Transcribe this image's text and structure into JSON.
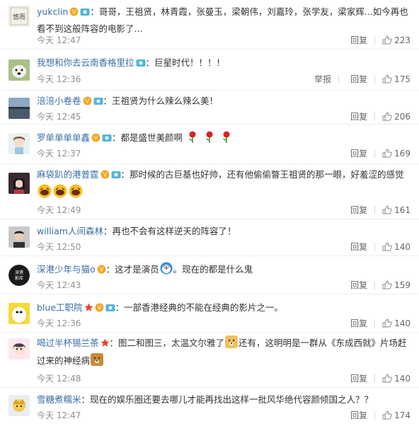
{
  "comments": [
    {
      "username": "yukclin",
      "text": "：哥哥，王祖贤，林青霞，张曼玉，梁朝伟，刘嘉玲，张学友，梁家辉...如今再也看不到这般阵容的电影了...",
      "time": "今天 12:47",
      "reply_label": "回复",
      "likes": "223",
      "avatar_icon": "calligraphy-avatar"
    },
    {
      "username": "我想和你去云南香格里拉",
      "text": "：巨星时代！！！！",
      "time": "今天 12:36",
      "report_label": "举报",
      "reply_label": "回复",
      "likes": "175",
      "avatar_icon": "dog-avatar"
    },
    {
      "username": "涪涪小卷卷",
      "text": "：王祖贤为什么辣么辣么美！",
      "time": "今天 12:45",
      "reply_label": "回复",
      "likes": "206",
      "avatar_icon": "lake-avatar"
    },
    {
      "username": "罗单单单单鑫",
      "text": "：都是盛世美颜啊",
      "time": "今天 12:37",
      "reply_label": "回复",
      "likes": "169",
      "avatar_icon": "girl-avatar"
    },
    {
      "username": "麻袋趴的港普霆",
      "text": "：那时候的古巨基也好帅，还有他偷偷瞥王祖贤的那一眼，好羞涩的感觉",
      "time": "今天 12:49",
      "reply_label": "回复",
      "likes": "161",
      "avatar_icon": "woman-avatar"
    },
    {
      "username": "william人间森林",
      "text": "：再也不会有这样逆天的阵容了！",
      "time": "今天 12:50",
      "reply_label": "回复",
      "likes": "140",
      "avatar_icon": "man-avatar"
    },
    {
      "username": "深港少年与猫o",
      "text": "：这才是演员",
      "text2": "。现在的都是什么鬼",
      "time": "今天 12:43",
      "reply_label": "回复",
      "likes": "159",
      "avatar_icon": "black-logo-avatar"
    },
    {
      "username": "blue工职院",
      "text": "：一部香港经典的不能在经典的影片之一。",
      "time": "今天 12:36",
      "reply_label": "回复",
      "likes": "140",
      "avatar_icon": "baymax-avatar"
    },
    {
      "username": "喝过半杯锡兰茶",
      "text": "：图二和图三，太温文尔雅了",
      "text2": "还有，这明明是一群从《东成西就》片场赶过来的神经病",
      "time": "今天 12:48",
      "reply_label": "回复",
      "likes": "140",
      "avatar_icon": "anime-avatar"
    },
    {
      "username": "雪糖煮糯米",
      "text": "：现在的娱乐圈还要去哪儿才能再找出这样一批风华绝代容颜倾国之人？？",
      "time": "今天 12:47",
      "reply_label": "回复",
      "likes": "174",
      "avatar_icon": "cartoon-avatar"
    }
  ],
  "colors": {
    "username": "#3a6ea5",
    "text": "#333333",
    "meta": "#8f8f8f",
    "divider": "#ececec"
  }
}
